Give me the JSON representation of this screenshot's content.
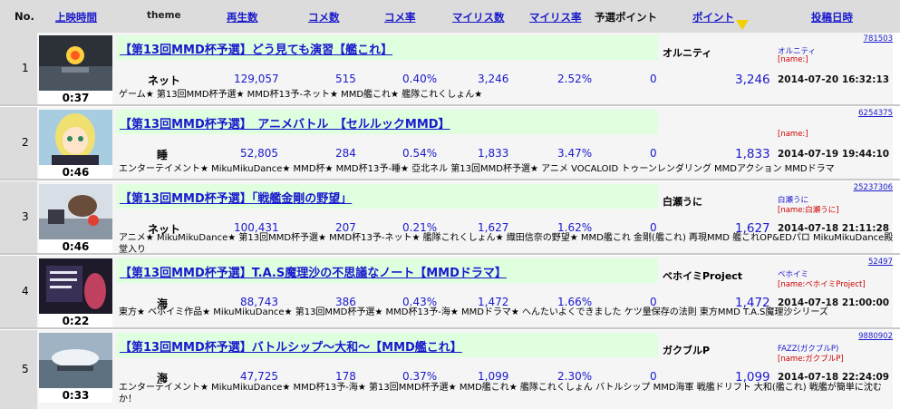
{
  "header": {
    "no": "No.",
    "duration": "上映時間",
    "theme": "theme",
    "views": "再生数",
    "comments": "コメ数",
    "comment_rate": "コメ率",
    "mylists": "マイリス数",
    "mylist_rate": "マイリス率",
    "preliminary_points": "予選ポイント",
    "points": "ポイント",
    "posted": "投稿日時"
  },
  "rows": [
    {
      "no": "1",
      "duration": "0:37",
      "title": "【第13回MMD杯予選】どう見ても演習【艦これ】",
      "uploader": "オルニティ",
      "video_id": "781503",
      "user_name": "オルニティ",
      "user_tag": "[name:]",
      "theme": "ネット",
      "views": "129,057",
      "comments": "515",
      "comment_rate": "0.40%",
      "mylists": "3,246",
      "mylist_rate": "2.52%",
      "preliminary_points": "0",
      "points": "3,246",
      "posted": "2014-07-20 16:32:13",
      "tags": "ゲーム★ 第13回MMD杯予選★ MMD杯13予-ネット★ MMD艦これ★ 艦隊これくしょん★"
    },
    {
      "no": "2",
      "duration": "0:46",
      "title": "【第13回MMD杯予選】　アニメバトル　【セルルックMMD】",
      "uploader": "",
      "video_id": "6254375",
      "user_name": "",
      "user_tag": "[name:]",
      "theme": "睡",
      "views": "52,805",
      "comments": "284",
      "comment_rate": "0.54%",
      "mylists": "1,833",
      "mylist_rate": "3.47%",
      "preliminary_points": "0",
      "points": "1,833",
      "posted": "2014-07-19 19:44:10",
      "tags": "エンターテイメント★ MikuMikuDance★ MMD杯★ MMD杯13予-睡★ 亞北ネル 第13回MMD杯予選★ アニメ VOCALOID トゥーンレンダリング MMDアクション MMDドラマ"
    },
    {
      "no": "3",
      "duration": "0:46",
      "title": "【第13回MMD杯予選】「戦艦金剛の野望」",
      "uploader": "白瀬うに",
      "video_id": "25237306",
      "user_name": "白瀬うに",
      "user_tag": "[name:白瀬うに]",
      "theme": "ネット",
      "views": "100,431",
      "comments": "207",
      "comment_rate": "0.21%",
      "mylists": "1,627",
      "mylist_rate": "1.62%",
      "preliminary_points": "0",
      "points": "1,627",
      "posted": "2014-07-18 21:11:28",
      "tags": "アニメ★ MikuMikuDance★ 第13回MMD杯予選★ MMD杯13予-ネット★ 艦隊これくしょん★ 織田信奈の野望★ MMD艦これ 金剛(艦これ) 再現MMD 艦これOP&EDパロ MikuMikuDance殿堂入り"
    },
    {
      "no": "4",
      "duration": "0:22",
      "title": "【第13回MMD杯予選】T.A.S魔理沙の不思議なノート【MMDドラマ】",
      "uploader": "ベホイミProject",
      "video_id": "52497",
      "user_name": "ベホイミ",
      "user_tag": "[name:ベホイミProject]",
      "theme": "海",
      "views": "88,743",
      "comments": "386",
      "comment_rate": "0.43%",
      "mylists": "1,472",
      "mylist_rate": "1.66%",
      "preliminary_points": "0",
      "points": "1,472",
      "posted": "2014-07-18 21:00:00",
      "tags": "東方★ ベホイミ作品★ MikuMikuDance★ 第13回MMD杯予選★ MMD杯13予-海★ MMDドラマ★ へんたいよくできました ケツ量保存の法則 東方MMD T.A.S魔理沙シリーズ"
    },
    {
      "no": "5",
      "duration": "0:33",
      "title": "【第13回MMD杯予選】バトルシップ～大和～【MMD艦これ】",
      "uploader": "ガクブルP",
      "video_id": "9880902",
      "user_name": "FAZZ(ガクブルP)",
      "user_tag": "[name:ガクブルP]",
      "theme": "海",
      "views": "47,725",
      "comments": "178",
      "comment_rate": "0.37%",
      "mylists": "1,099",
      "mylist_rate": "2.30%",
      "preliminary_points": "0",
      "points": "1,099",
      "posted": "2014-07-18 22:24:09",
      "tags": "エンターテイメント★ MikuMikuDance★ MMD杯13予-海★ 第13回MMD杯予選★ MMD艦これ★ 艦隊これくしょん バトルシップ MMD海軍 戦艦ドリフト 大和(艦これ) 戦艦が簡単に沈むか！"
    }
  ],
  "colors": {
    "link": "#1a1acc",
    "header_bg": "#dcdcdc",
    "title_bg": "#dfffdf",
    "row_bg": "#f5f5f5",
    "user_tag": "#cc0000",
    "sort_indicator": "#f2d000"
  },
  "icons": {
    "sort_indicator": "sort-desc-triangle-icon"
  }
}
